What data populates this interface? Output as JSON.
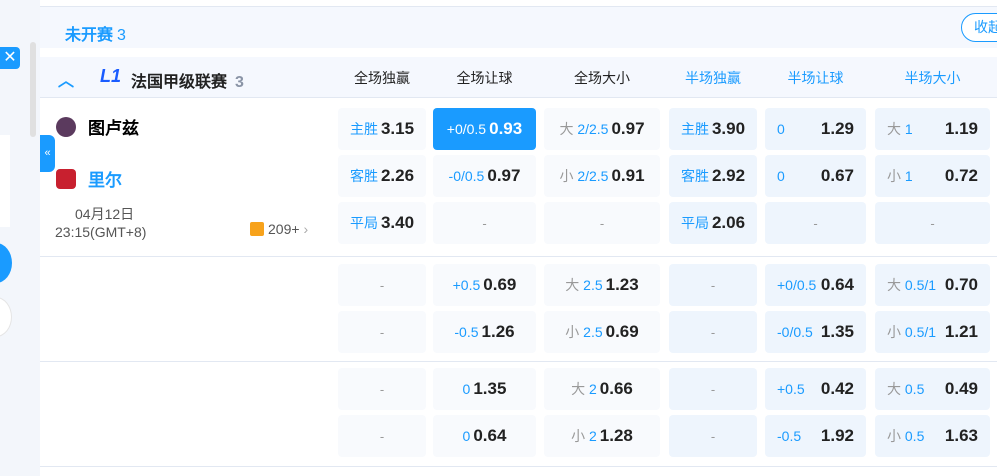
{
  "status": {
    "title": "未开赛",
    "count": "3",
    "fold": "收起"
  },
  "league": {
    "name": "法国甲级联赛",
    "count": "3"
  },
  "headers": [
    "全场独赢",
    "全场让球",
    "全场大小",
    "半场独赢",
    "半场让球",
    "半场大小"
  ],
  "match": {
    "home": "图卢兹",
    "away": "里尔",
    "date": "04月12日",
    "time": "23:15(GMT+8)",
    "more": "209+"
  },
  "colors": {
    "accent": "#1a9bff"
  },
  "rows": [
    [
      {
        "l": "主胜",
        "v": "3.15"
      },
      {
        "l": "+0/0.5",
        "v": "0.93",
        "sel": true
      },
      {
        "p": "大",
        "l": "2/2.5",
        "v": "0.97"
      },
      {
        "l": "主胜",
        "v": "3.90"
      },
      {
        "l": "0",
        "v": "1.29"
      },
      {
        "p": "大",
        "l": "1",
        "v": "1.19"
      }
    ],
    [
      {
        "l": "客胜",
        "v": "2.26"
      },
      {
        "l": "-0/0.5",
        "v": "0.97"
      },
      {
        "p": "小",
        "l": "2/2.5",
        "v": "0.91"
      },
      {
        "l": "客胜",
        "v": "2.92"
      },
      {
        "l": "0",
        "v": "0.67"
      },
      {
        "p": "小",
        "l": "1",
        "v": "0.72"
      }
    ],
    [
      {
        "l": "平局",
        "v": "3.40"
      },
      {
        "d": "-"
      },
      {
        "d": "-"
      },
      {
        "l": "平局",
        "v": "2.06"
      },
      {
        "d": "-"
      },
      {
        "d": "-"
      }
    ],
    [
      {
        "d": "-"
      },
      {
        "l": "+0.5",
        "v": "0.69"
      },
      {
        "p": "大",
        "l": "2.5",
        "v": "1.23"
      },
      {
        "d": "-"
      },
      {
        "l": "+0/0.5",
        "v": "0.64"
      },
      {
        "p": "大",
        "l": "0.5/1",
        "v": "0.70"
      }
    ],
    [
      {
        "d": "-"
      },
      {
        "l": "-0.5",
        "v": "1.26"
      },
      {
        "p": "小",
        "l": "2.5",
        "v": "0.69"
      },
      {
        "d": "-"
      },
      {
        "l": "-0/0.5",
        "v": "1.35"
      },
      {
        "p": "小",
        "l": "0.5/1",
        "v": "1.21"
      }
    ],
    [
      {
        "d": "-"
      },
      {
        "l": "0",
        "v": "1.35"
      },
      {
        "p": "大",
        "l": "2",
        "v": "0.66"
      },
      {
        "d": "-"
      },
      {
        "l": "+0.5",
        "v": "0.42"
      },
      {
        "p": "大",
        "l": "0.5",
        "v": "0.49"
      }
    ],
    [
      {
        "d": "-"
      },
      {
        "l": "0",
        "v": "0.64"
      },
      {
        "p": "小",
        "l": "2",
        "v": "1.28"
      },
      {
        "d": "-"
      },
      {
        "l": "-0.5",
        "v": "1.92"
      },
      {
        "p": "小",
        "l": "0.5",
        "v": "1.63"
      }
    ]
  ]
}
